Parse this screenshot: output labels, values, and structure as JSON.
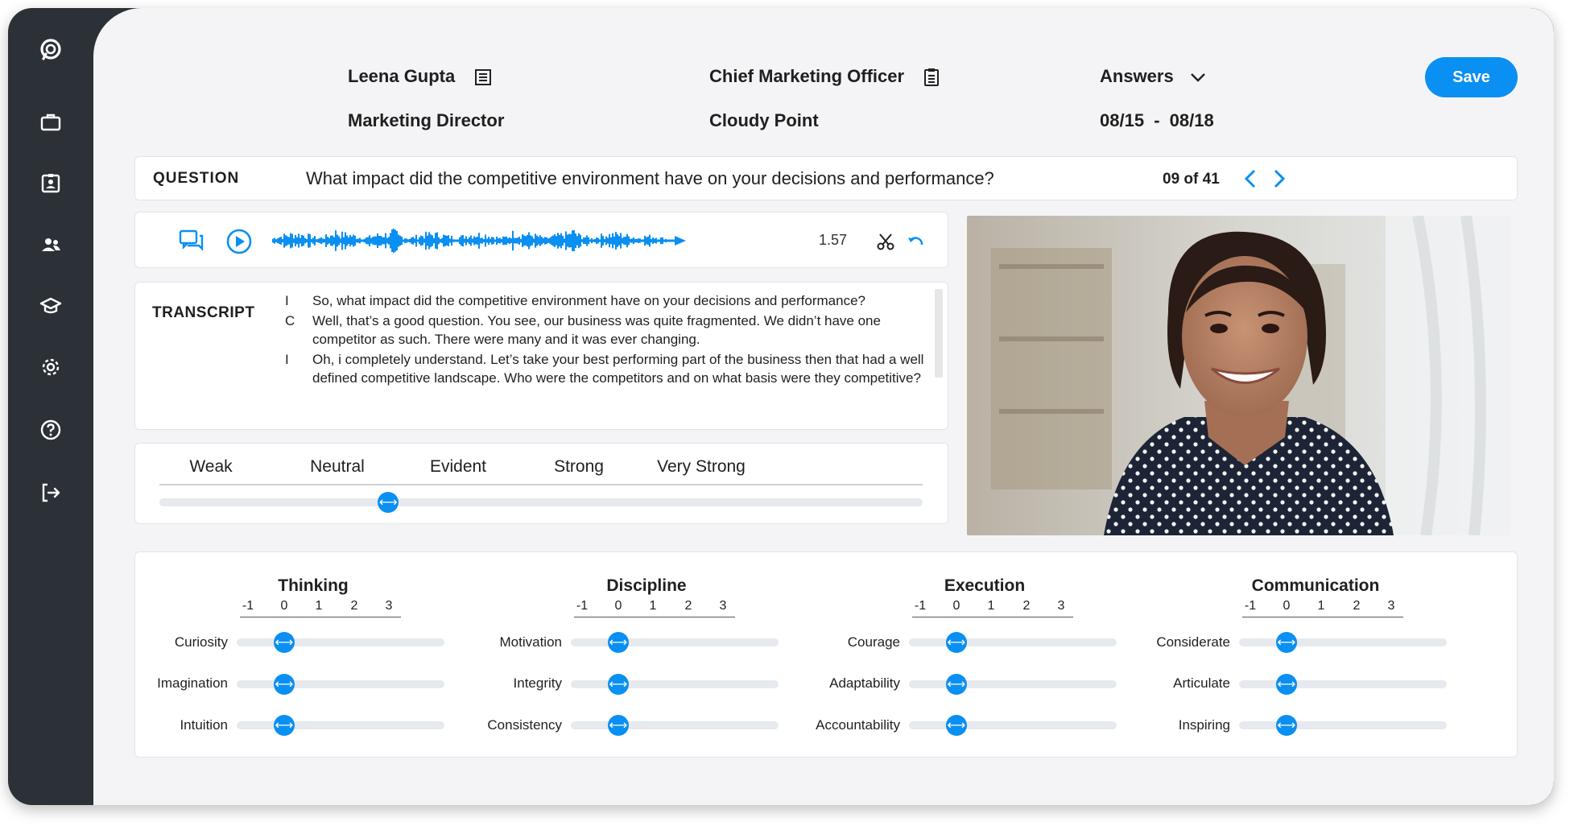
{
  "header": {
    "candidate_name": "Leena Gupta",
    "candidate_title": "Marketing Director",
    "role": "Chief Marketing Officer",
    "company": "Cloudy Point",
    "view": "Answers",
    "date_from": "08/15",
    "date_sep": "-",
    "date_to": "08/18",
    "save_label": "Save"
  },
  "question": {
    "label": "QUESTION",
    "text": "What impact did the competitive environment have on your decisions and performance?",
    "counter": "09 of 41"
  },
  "audio": {
    "time": "1.57"
  },
  "transcript": {
    "label": "TRANSCRIPT",
    "lines": [
      {
        "speaker": "I",
        "text": "So, what impact did the competitive environment have on your decisions and performance?"
      },
      {
        "speaker": "C",
        "text": "Well, that’s a good question. You see, our business was quite fragmented. We didn’t have one competitor as such. There were many and it was ever changing."
      },
      {
        "speaker": "I",
        "text": "Oh, i completely understand. Let’s take your best performing part of the business then that had a well defined competitive landscape. Who were the competitors and on what basis were they competitive?"
      }
    ]
  },
  "rating": {
    "labels": [
      "Weak",
      "Neutral",
      "Evident",
      "Strong",
      "Very Strong"
    ],
    "selected_index": 1,
    "value_fraction": 0.3
  },
  "traits": {
    "scale_ticks": [
      "-1",
      "0",
      "1",
      "2",
      "3"
    ],
    "groups": [
      {
        "title": "Thinking",
        "items": [
          {
            "name": "Curiosity",
            "value": 0
          },
          {
            "name": "Imagination",
            "value": 0
          },
          {
            "name": "Intuition",
            "value": 0
          }
        ]
      },
      {
        "title": "Discipline",
        "items": [
          {
            "name": "Motivation",
            "value": 0
          },
          {
            "name": "Integrity",
            "value": 0
          },
          {
            "name": "Consistency",
            "value": 0
          }
        ]
      },
      {
        "title": "Execution",
        "items": [
          {
            "name": "Courage",
            "value": 0
          },
          {
            "name": "Adaptability",
            "value": 0
          },
          {
            "name": "Accountability",
            "value": 0
          }
        ]
      },
      {
        "title": "Communication",
        "items": [
          {
            "name": "Considerate",
            "value": 0
          },
          {
            "name": "Articulate",
            "value": 0
          },
          {
            "name": "Inspiring",
            "value": 0
          }
        ]
      }
    ]
  },
  "colors": {
    "accent": "#0a8ff2",
    "sidebar": "#2b3137",
    "background": "#f4f4f6"
  },
  "icons": {
    "sidebar": [
      "chat-logo-icon",
      "briefcase-icon",
      "id-card-icon",
      "users-icon",
      "graduation-cap-icon",
      "gear-icon",
      "help-icon",
      "logout-icon"
    ]
  }
}
